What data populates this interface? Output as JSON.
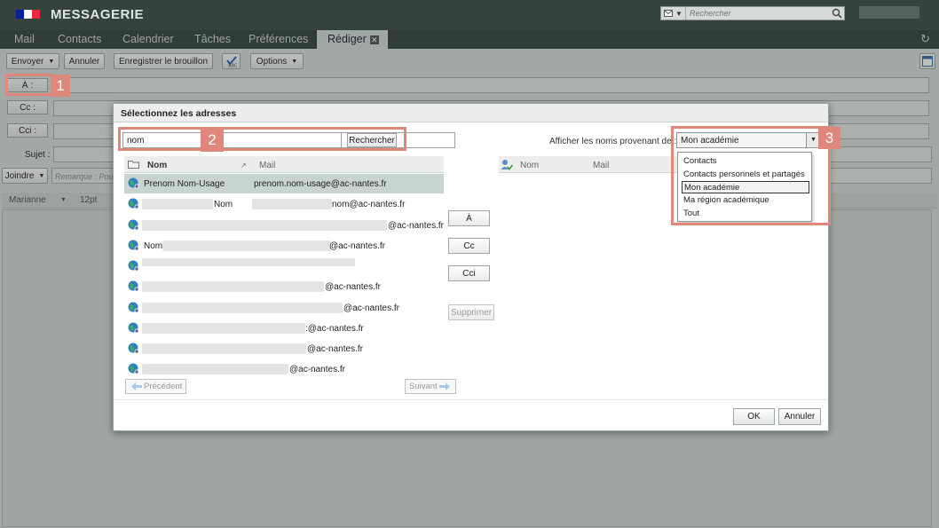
{
  "header": {
    "app_title": "MESSAGERIE",
    "search_placeholder": "Rechercher",
    "flag_colors": [
      "#002395",
      "#ffffff",
      "#ed2939"
    ]
  },
  "tabs": [
    {
      "label": "Mail"
    },
    {
      "label": "Contacts"
    },
    {
      "label": "Calendrier"
    },
    {
      "label": "Tâches"
    },
    {
      "label": "Préférences"
    },
    {
      "label": "Rédiger",
      "active": true
    }
  ],
  "toolbar": {
    "send": "Envoyer",
    "cancel": "Annuler",
    "save_draft": "Enregistrer le brouillon",
    "options": "Options"
  },
  "compose": {
    "to_label": "À :",
    "cc_label": "Cc :",
    "bcc_label": "Cci :",
    "subject_label": "Sujet :",
    "attach_label": "Joindre",
    "remark_placeholder": "Remarque : Pou",
    "font_name": "Marianne",
    "font_size": "12pt"
  },
  "dialog": {
    "title": "Sélectionnez les adresses",
    "search_value": "nom",
    "search_button": "Rechercher",
    "source_label": "Afficher les noms provenant de :",
    "source_selected": "Mon académie",
    "source_options": [
      "Contacts",
      "Contacts personnels et partagés",
      "Mon académie",
      "Ma région académique",
      "Tout"
    ],
    "left_columns": {
      "name": "Nom",
      "mail": "Mail"
    },
    "right_columns": {
      "name": "Nom",
      "mail": "Mail"
    },
    "results": [
      {
        "name": "Prenom Nom-Usage",
        "mail": "prenom.nom-usage@ac-nantes.fr"
      },
      {
        "name": "Nom",
        "mail": "nom@ac-nantes.fr"
      },
      {
        "name": "",
        "mail": "@ac-nantes.fr"
      },
      {
        "name": "Nom",
        "mail": "@ac-nantes.fr"
      },
      {
        "name": "",
        "mail": ""
      },
      {
        "name": "",
        "mail": "@ac-nantes.fr"
      },
      {
        "name": "",
        "mail": "@ac-nantes.fr"
      },
      {
        "name": "",
        "mail": ":@ac-nantes.fr"
      },
      {
        "name": "",
        "mail": "@ac-nantes.fr"
      },
      {
        "name": "",
        "mail": "@ac-nantes.fr"
      }
    ],
    "to_button": "À",
    "cc_button": "Cc",
    "bcc_button": "Cci",
    "delete_button": "Supprimer",
    "prev_button": "Précédent",
    "next_button": "Suivant",
    "ok_button": "OK",
    "cancel_button": "Annuler"
  },
  "annotations": {
    "step1": "1",
    "step2": "2",
    "step3": "3",
    "color": "#e0877b"
  }
}
